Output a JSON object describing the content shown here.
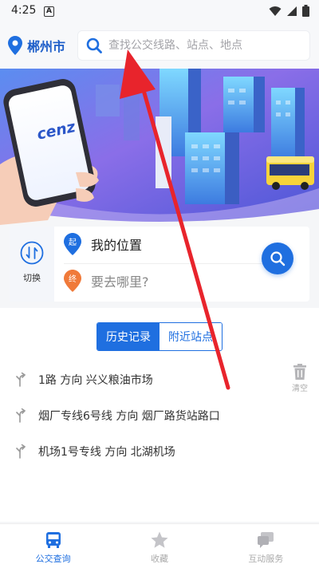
{
  "status_bar": {
    "time": "4:25",
    "notification_icon": "A"
  },
  "header": {
    "city": "郴州市",
    "search": {
      "placeholder": "查找公交线路、站点、地点",
      "value": ""
    }
  },
  "banner": {
    "phone_brand": "cenz"
  },
  "route_planner": {
    "swap_label": "切换",
    "from_badge": "起",
    "from_text": "我的位置",
    "to_badge": "终",
    "to_text": "要去哪里?"
  },
  "tabs": [
    {
      "label": "历史记录",
      "active": true
    },
    {
      "label": "附近站点",
      "active": false
    }
  ],
  "clear_label": "清空",
  "history": [
    {
      "text": "1路 方向 兴义粮油市场"
    },
    {
      "text": "烟厂专线6号线 方向 烟厂路货站路口"
    },
    {
      "text": "机场1号专线 方向 北湖机场"
    }
  ],
  "bottom_nav": [
    {
      "label": "公交查询",
      "icon": "bus-icon",
      "active": true
    },
    {
      "label": "收藏",
      "icon": "star-icon",
      "active": false
    },
    {
      "label": "互动服务",
      "icon": "chat-icon",
      "active": false
    }
  ],
  "colors": {
    "accent": "#1f6fe0",
    "annotation_arrow": "#e8242c",
    "to_badge": "#f07a3a"
  }
}
